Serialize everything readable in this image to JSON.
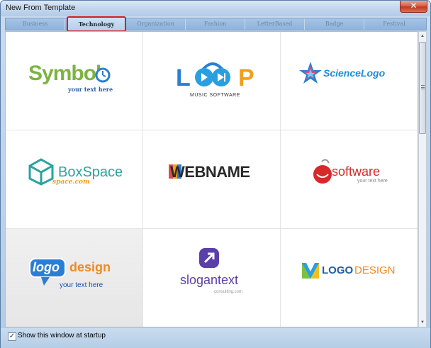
{
  "window": {
    "title": "New From Template",
    "close_glyph": "✕"
  },
  "tabs": [
    {
      "label": "Business",
      "active": false
    },
    {
      "label": "Technology",
      "active": true
    },
    {
      "label": "Organization",
      "active": false
    },
    {
      "label": "Fashion",
      "active": false
    },
    {
      "label": "LetterBased",
      "active": false
    },
    {
      "label": "Badge",
      "active": false
    },
    {
      "label": "Festival",
      "active": false
    }
  ],
  "templates": [
    {
      "name": "Symbol",
      "tagline": "your text here",
      "icon": "clock-icon"
    },
    {
      "name": "LOOP",
      "tagline": "MUSIC SOFTWARE",
      "icon": "headphones-play-icon"
    },
    {
      "name": "ScienceLogo",
      "icon": "star-cubes-icon"
    },
    {
      "name": "BoxSpace",
      "tagline": "space.com",
      "icon": "box-outline-icon"
    },
    {
      "name": "WEBNAME",
      "icon": "letter-blocks-icon"
    },
    {
      "name": "software",
      "tagline": "your text here",
      "icon": "apple-smile-icon"
    },
    {
      "name_part1": "logo",
      "name_part2": "design",
      "tagline": "your text here",
      "icon": "speech-bubble-icon",
      "selected": true
    },
    {
      "name": "slogantext",
      "tagline": "consulting.com",
      "icon": "arrow-square-icon"
    },
    {
      "name_part1": "LOGO",
      "name_part2": "DESIGN",
      "icon": "v-square-icon"
    }
  ],
  "footer": {
    "checkbox_label": "Show this window at startup",
    "checked": true,
    "check_glyph": "✓"
  },
  "scrollbar": {
    "up_glyph": "▲",
    "down_glyph": "▼"
  },
  "colors": {
    "selected_tab_border": "#d21f1f",
    "green_logo": "#7cb342",
    "blue_logo": "#2a7fd4",
    "teal_logo": "#2aa3a0",
    "red_logo": "#d42a2a"
  }
}
